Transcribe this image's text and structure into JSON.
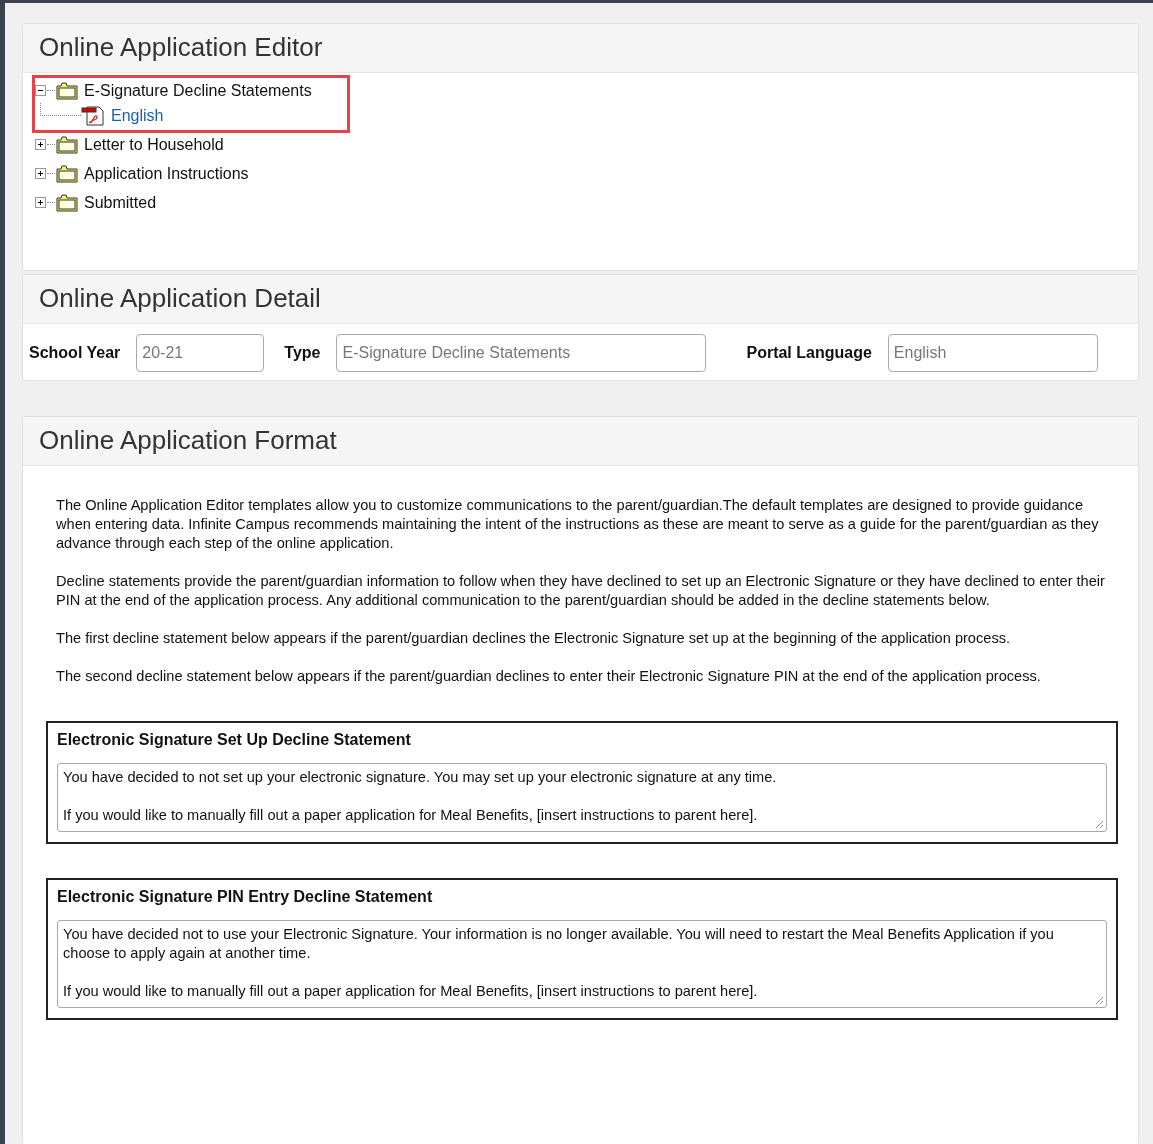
{
  "editor": {
    "title": "Online Application Editor",
    "tree": [
      {
        "label": "E-Signature Decline Statements",
        "expanded": true,
        "highlighted": true,
        "children": [
          {
            "label": "English",
            "kind": "document"
          }
        ]
      },
      {
        "label": "Letter to Household",
        "expanded": false,
        "highlighted": false
      },
      {
        "label": "Application Instructions",
        "expanded": false,
        "highlighted": false
      },
      {
        "label": "Submitted",
        "expanded": false,
        "highlighted": false
      }
    ]
  },
  "detail": {
    "title": "Online Application Detail",
    "fields": [
      {
        "label": "School Year",
        "value": "20-21"
      },
      {
        "label": "Type",
        "value": "E-Signature Decline Statements"
      },
      {
        "label": "Portal Language",
        "value": "English"
      }
    ]
  },
  "format": {
    "title": "Online Application Format",
    "paragraphs": [
      "The Online Application Editor templates allow you to customize communications to the parent/guardian.The default templates are designed to provide guidance when entering data. Infinite Campus recommends maintaining the intent of the instructions as these are meant to serve as a guide for the parent/guardian as they advance through each step of the online application.",
      "Decline statements provide the parent/guardian information to follow when they have declined to set up an Electronic Signature or they have declined to enter their PIN at the end of the application process. Any additional communication to the parent/guardian should be added in the decline statements below.",
      "The first decline statement below appears if the parent/guardian declines the Electronic Signature set up at the beginning of the application process.",
      "The second decline statement below appears if the parent/guardian declines to enter their Electronic Signature PIN at the end of the application process."
    ],
    "statements": [
      {
        "title": "Electronic Signature Set Up Decline Statement",
        "text": [
          "You have decided to not set up your electronic signature. You may set up your electronic signature at any time.",
          "If you would like to manually fill out a paper application for Meal Benefits, [insert instructions to parent here]."
        ]
      },
      {
        "title": "Electronic Signature PIN Entry Decline Statement",
        "text": [
          "You have decided not to use your Electronic Signature. Your information is no longer available. You will need to restart the Meal Benefits Application if you choose to apply again at another time.",
          "If you would like to manually fill out a paper application for Meal Benefits, [insert instructions to parent here]."
        ]
      }
    ]
  }
}
